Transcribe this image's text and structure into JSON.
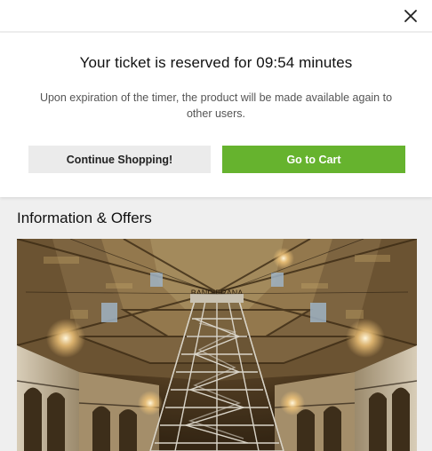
{
  "header": {
    "close_icon": "close-icon"
  },
  "modal": {
    "title": "Your ticket is reserved for 09:54 minutes",
    "description": "Upon expiration of the timer, the product will be made available again to other users.",
    "continue_label": "Continue Shopping!",
    "cart_label": "Go to Cart",
    "cart_color": "#66b32e"
  },
  "info": {
    "title": "Information & Offers",
    "banner_text": "BANDIERANA"
  }
}
